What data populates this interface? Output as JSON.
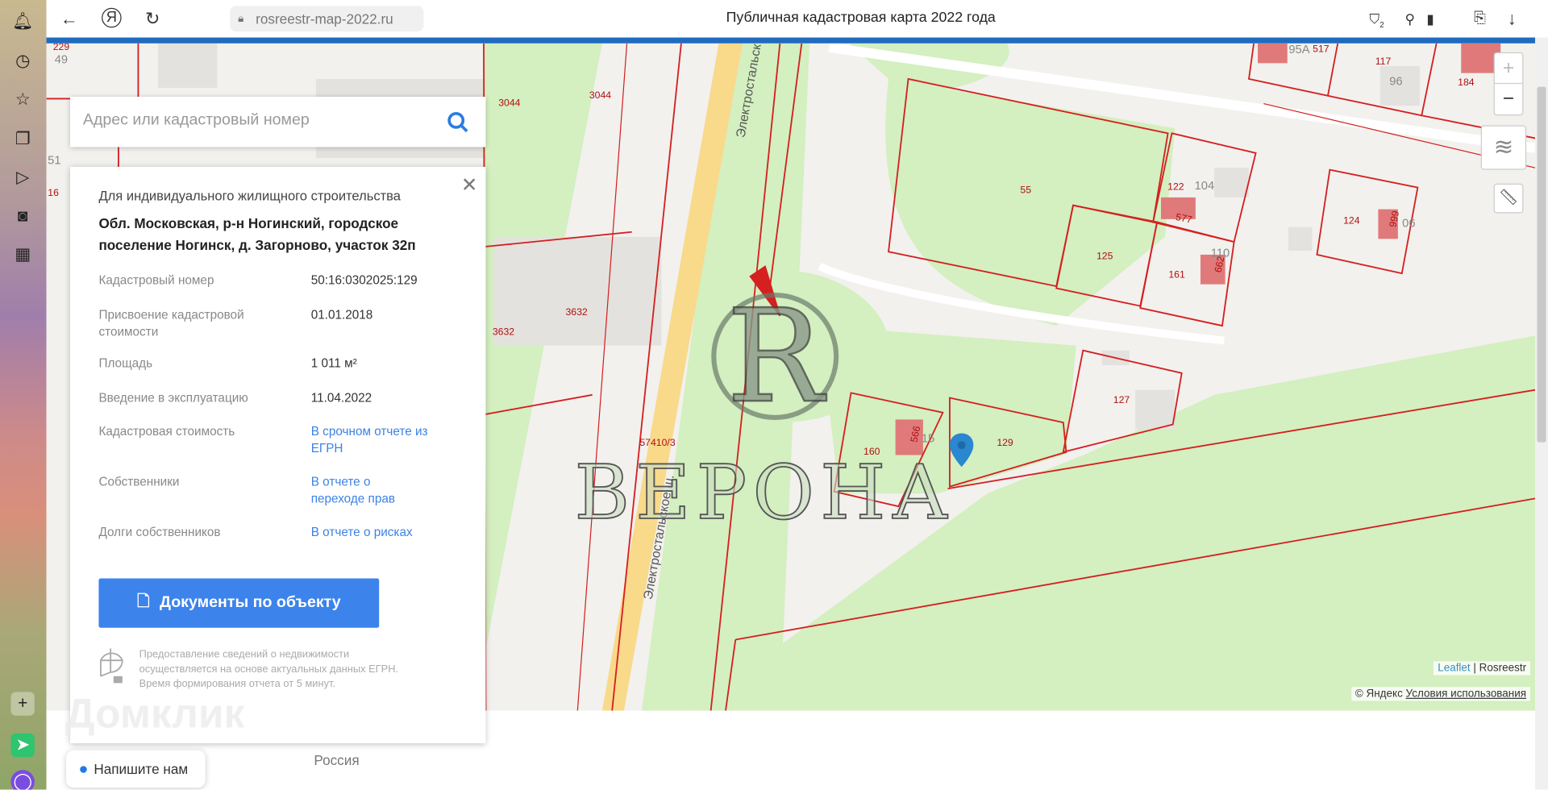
{
  "browser": {
    "url": "rosreestr-map-2022.ru",
    "title": "Публичная кадастровая карта 2022 года",
    "badge_count": "2"
  },
  "search": {
    "placeholder": "Адрес или кадастровый номер"
  },
  "panel": {
    "purpose": "Для индивидуального жилищного строительства",
    "address": "Обл. Московская, р-н Ногинский, городское поселение Ногинск, д. Загорново, участок 32п",
    "rows": [
      {
        "label": "Кадастровый номер",
        "value": "50:16:0302025:129"
      },
      {
        "label": "Присвоение кадастровой стоимости",
        "value": "01.01.2018"
      },
      {
        "label": "Площадь",
        "value": "1 011 м²"
      },
      {
        "label": "Введение в эксплуатацию",
        "value": "11.04.2022"
      },
      {
        "label": "Кадастровая стоимость",
        "value": "В срочном отчете из ЕГРН"
      },
      {
        "label": "Собственники",
        "value": "В отчете о переходе прав"
      },
      {
        "label": "Долги собственников",
        "value": "В отчете о рисках"
      }
    ],
    "docs_button": "Документы по объекту",
    "note": "Предоставление сведений о недвижимости осуществляется на основе актуальных данных ЕГРН. Время формирования отчета от 5 минут."
  },
  "map": {
    "labels": [
      "229",
      "49",
      "51",
      "16",
      "3044",
      "3044",
      "3632",
      "3632",
      "57410/3",
      "55",
      "125",
      "161",
      "122",
      "104",
      "577",
      "662",
      "110",
      "124",
      "999",
      "06",
      "127",
      "129",
      "160",
      "566",
      "15",
      "117",
      "96",
      "184",
      "517",
      "95А"
    ],
    "road_name": "Электростальское ш.",
    "road_name_top": "Электростальск",
    "controls": {
      "zoom_in": "+",
      "zoom_out": "−"
    },
    "attribution": {
      "leaflet": "Leaflet",
      "sep": " | ",
      "rosreestr": "Rosreestr",
      "yandex": "© Яндекс",
      "terms": "Условия использования"
    },
    "watermark": "ВЕРОНА",
    "watermark2": "Домклик"
  },
  "footer": {
    "country": "Россия",
    "chat": "Напишите нам"
  },
  "colors": {
    "accent": "#3c83ec",
    "parcel": "#d42020",
    "green": "#d4efc0",
    "road": "#f9d98a"
  }
}
